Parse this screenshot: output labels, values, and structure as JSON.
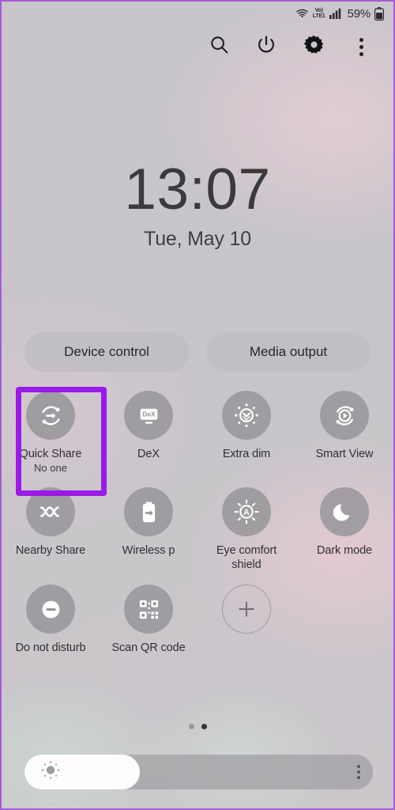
{
  "statusbar": {
    "wifi_icon": "wifi-icon",
    "volte_line1": "Vo)",
    "volte_line2": "LTE1",
    "signal_icon": "signal-bars-icon",
    "battery_percent": "59%",
    "battery_icon": "battery-icon"
  },
  "toolbar": {
    "search_icon": "search-icon",
    "power_icon": "power-icon",
    "settings_icon": "gear-icon",
    "more_icon": "more-options-icon"
  },
  "clock": {
    "time": "13:07",
    "date": "Tue, May 10"
  },
  "quick_actions": {
    "device_control": "Device control",
    "media_output": "Media output"
  },
  "tiles": [
    {
      "label": "Quick Share",
      "sub": "No one",
      "icon": "quick-share-icon",
      "state": "off",
      "highlighted": true
    },
    {
      "label": "DeX",
      "sub": "",
      "icon": "dex-icon",
      "state": "off",
      "highlighted": false
    },
    {
      "label": "Extra dim",
      "sub": "",
      "icon": "extra-dim-icon",
      "state": "off",
      "highlighted": false
    },
    {
      "label": "Smart View",
      "sub": "",
      "icon": "smart-view-icon",
      "state": "off",
      "highlighted": false
    },
    {
      "label": "Nearby Share",
      "sub": "",
      "icon": "nearby-share-icon",
      "state": "off",
      "highlighted": false
    },
    {
      "label": "Wireless p",
      "sub": "",
      "icon": "wireless-power-share-icon",
      "state": "off",
      "highlighted": false
    },
    {
      "label": "Eye comfort shield",
      "sub": "",
      "icon": "eye-comfort-shield-icon",
      "state": "off",
      "highlighted": false
    },
    {
      "label": "Dark mode",
      "sub": "",
      "icon": "dark-mode-icon",
      "state": "off",
      "highlighted": false
    },
    {
      "label": "Do not disturb",
      "sub": "",
      "icon": "do-not-disturb-icon",
      "state": "off",
      "highlighted": false
    },
    {
      "label": "Scan QR code",
      "sub": "",
      "icon": "qr-code-icon",
      "state": "off",
      "highlighted": false
    },
    {
      "label": "",
      "sub": "",
      "icon": "add-icon",
      "state": "outline",
      "highlighted": false
    }
  ],
  "pagination": {
    "total": 2,
    "active": 2
  },
  "brightness": {
    "value_percent": 33,
    "sun_icon": "brightness-sun-icon",
    "menu_icon": "more-options-icon"
  },
  "colors": {
    "highlight": "#9a1ae8",
    "frame": "#a45cd6",
    "tile_circle": "#949296",
    "text": "#303033"
  }
}
